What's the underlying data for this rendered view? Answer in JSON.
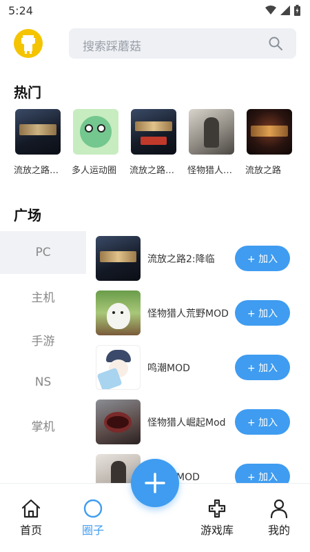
{
  "status_bar": {
    "time": "5:24"
  },
  "search": {
    "placeholder": "搜索踩蘑菇"
  },
  "sections": {
    "hot_title": "热门",
    "square_title": "广场"
  },
  "hot": [
    {
      "label": "流放之路…"
    },
    {
      "label": "多人运动圈"
    },
    {
      "label": "流放之路…"
    },
    {
      "label": "怪物猎人…"
    },
    {
      "label": "流放之路"
    }
  ],
  "categories": [
    {
      "label": "PC",
      "active": true
    },
    {
      "label": "主机"
    },
    {
      "label": "手游"
    },
    {
      "label": "NS"
    },
    {
      "label": "掌机"
    }
  ],
  "circles": [
    {
      "title": "流放之路2:降临",
      "join": "+ 加入"
    },
    {
      "title": "怪物猎人荒野MOD",
      "join": "+ 加入"
    },
    {
      "title": "鸣潮MOD",
      "join": "+ 加入"
    },
    {
      "title": "怪物猎人崛起Mod",
      "join": "+ 加入"
    },
    {
      "title": "人世界MOD",
      "join": "+ 加入"
    }
  ],
  "tabs": [
    {
      "label": "首页",
      "icon": "home-icon"
    },
    {
      "label": "圈子",
      "icon": "circle-icon",
      "active": true
    },
    {
      "label": "游戏库",
      "icon": "gamepad-icon"
    },
    {
      "label": "我的",
      "icon": "user-icon"
    }
  ],
  "colors": {
    "accent": "#3f9cf0",
    "avatar": "#f5c400",
    "search_bg": "#eef0f4",
    "sidebar_active": "#f0f2f5"
  }
}
